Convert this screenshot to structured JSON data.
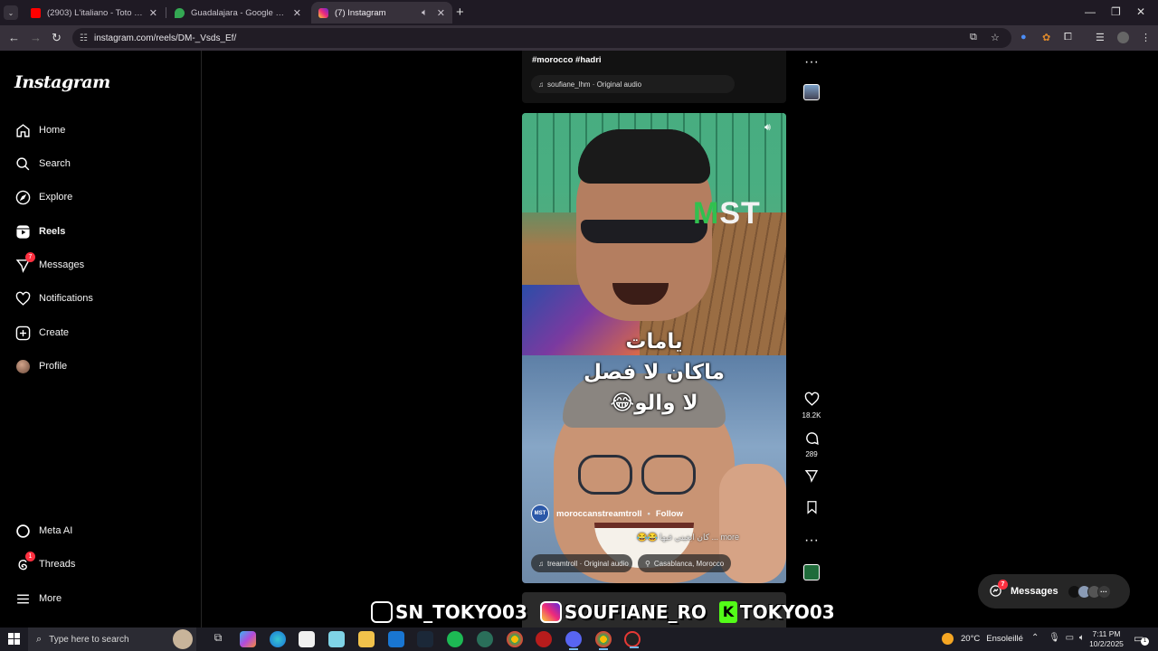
{
  "browser": {
    "tabs": [
      {
        "title": "(2903) L'italiano - Toto Cutugno",
        "favicon_color": "#ff0000"
      },
      {
        "title": "Guadalajara - Google Maps",
        "favicon_color": "#34a853"
      },
      {
        "title": "(7) Instagram",
        "favicon_color": "#e1306c"
      }
    ],
    "url": "instagram.com/reels/DM-_Vsds_Ef/"
  },
  "instagram": {
    "logo": "Instagram",
    "nav": [
      {
        "label": "Home",
        "icon": "home-icon"
      },
      {
        "label": "Search",
        "icon": "search-icon"
      },
      {
        "label": "Explore",
        "icon": "compass-icon"
      },
      {
        "label": "Reels",
        "icon": "reels-icon"
      },
      {
        "label": "Messages",
        "icon": "messenger-icon",
        "badge": "7"
      },
      {
        "label": "Notifications",
        "icon": "heart-icon"
      },
      {
        "label": "Create",
        "icon": "plus-square-icon"
      },
      {
        "label": "Profile",
        "icon": "avatar"
      }
    ],
    "bottom_nav": [
      {
        "label": "Meta AI",
        "icon": "meta-ai-icon"
      },
      {
        "label": "Threads",
        "icon": "threads-icon",
        "badge": "1"
      },
      {
        "label": "More",
        "icon": "hamburger-icon"
      }
    ],
    "prev_reel": {
      "tags": "#morocco #hadri",
      "audio": "soufiane_lhm · Original audio"
    },
    "reel": {
      "logo_text_m": "M",
      "logo_text_rest": "ST",
      "caption_lines": [
        "يامات",
        "ماكان لا فصل",
        "لا والو😂"
      ],
      "author": "moroccanstreamtroll",
      "follow": "Follow",
      "description": "😂😂 كان ابغيني فيها ... more",
      "audio": "treamtroll · Original audio",
      "location": "Casablanca, Morocco",
      "likes": "18.2K",
      "comments": "289"
    },
    "watermark": {
      "tiktok": "SN_TOKYO03",
      "instagram": "SOUFIANE_RO",
      "kick": "TOKYO03"
    },
    "messages_float": {
      "label": "Messages",
      "badge": "7"
    }
  },
  "taskbar": {
    "search_placeholder": "Type here to search",
    "weather_temp": "20°C",
    "weather_desc": "Ensoleillé",
    "time": "7:11 PM",
    "date": "10/2/2025",
    "notifications": "1"
  }
}
